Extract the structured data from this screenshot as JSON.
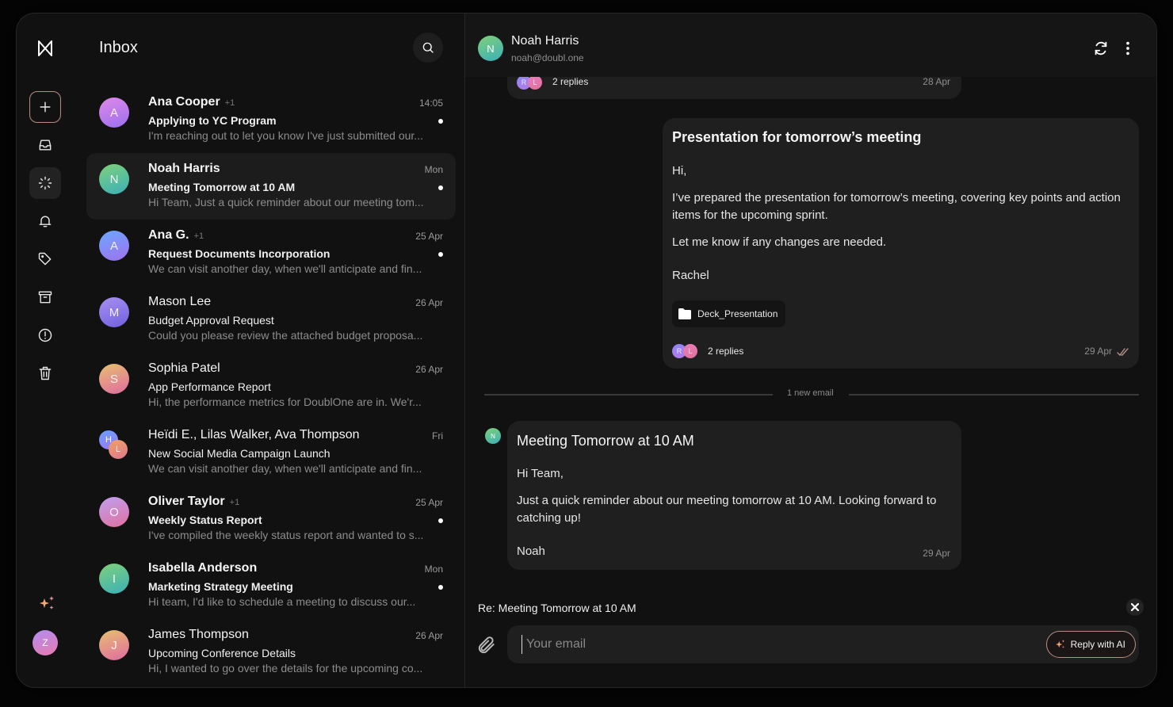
{
  "app": {
    "logo": "doublone-logo",
    "colors": {
      "accent": "#b88e84",
      "bg": "#111111",
      "card": "#1f1f1f",
      "selected": "#1c1c1c"
    }
  },
  "rail": {
    "items": [
      {
        "name": "compose",
        "icon": "plus-icon"
      },
      {
        "name": "inbox",
        "icon": "inbox-icon"
      },
      {
        "name": "loading",
        "icon": "loader-icon",
        "active": true
      },
      {
        "name": "notifications",
        "icon": "bell-icon"
      },
      {
        "name": "tags",
        "icon": "tag-icon"
      },
      {
        "name": "archive",
        "icon": "archive-icon"
      },
      {
        "name": "spam",
        "icon": "alert-icon"
      },
      {
        "name": "trash",
        "icon": "trash-icon"
      }
    ],
    "ai_icon": "sparkles-icon",
    "user_initial": "Z"
  },
  "list": {
    "title": "Inbox",
    "search_icon": "search-icon",
    "items": [
      {
        "initial": "A",
        "sender": "Ana Cooper",
        "extra": "+1",
        "time": "14:05",
        "subject": "Applying to YC Program",
        "preview": "I'm reaching out to let you know I've just submitted our...",
        "unread": true,
        "gradient": "linear-gradient(160deg,#e08ae8,#9b6ef0)"
      },
      {
        "initial": "N",
        "sender": "Noah Harris",
        "extra": "",
        "time": "Mon",
        "subject": "Meeting Tomorrow at 10 AM",
        "preview": "Hi Team, Just a quick reminder about our meeting tom...",
        "unread": true,
        "selected": true,
        "gradient": "linear-gradient(160deg,#7fd07a,#3ab0b8)"
      },
      {
        "initial": "A",
        "sender": "Ana G.",
        "extra": "+1",
        "time": "25 Apr",
        "subject": "Request Documents Incorporation",
        "preview": "We can visit another day, when we'll anticipate and fin...",
        "unread": true,
        "gradient": "linear-gradient(160deg,#6aa8ff,#a070f0)"
      },
      {
        "initial": "M",
        "sender": "Mason Lee",
        "extra": "",
        "time": "26 Apr",
        "subject": "Budget Approval Request",
        "preview": "Could you please review the attached budget proposa...",
        "unread": false,
        "gradient": "linear-gradient(160deg,#a890f0,#7060e0)"
      },
      {
        "initial": "S",
        "sender": "Sophia Patel",
        "extra": "",
        "time": "26 Apr",
        "subject": "App Performance Report",
        "preview": "Hi, the performance metrics for DoublOne are in. We'r...",
        "unread": false,
        "gradient": "linear-gradient(160deg,#e8c070,#e06aa0)"
      },
      {
        "initial": "H",
        "initial2": "L",
        "sender": "Heïdi E., Lilas Walker, Ava Thompson",
        "extra": "",
        "time": "Fri",
        "subject": "New Social Media Campaign Launch",
        "preview": "We can visit another day, when we'll anticipate and fin...",
        "unread": false,
        "pair": true
      },
      {
        "initial": "O",
        "sender": "Oliver Taylor",
        "extra": "+1",
        "time": "25 Apr",
        "subject": "Weekly Status Report",
        "preview": "I've compiled the weekly status report and wanted to s...",
        "unread": true,
        "gradient": "linear-gradient(160deg,#c0a0f0,#e070a0)"
      },
      {
        "initial": "I",
        "sender": "Isabella Anderson",
        "extra": "",
        "time": "Mon",
        "subject": "Marketing Strategy Meeting",
        "preview": "Hi team, I'd like to schedule a meeting to discuss our...",
        "unread": true,
        "gradient": "linear-gradient(160deg,#7fd07a,#3ab0b8)"
      },
      {
        "initial": "J",
        "sender": "James Thompson",
        "extra": "",
        "time": "26 Apr",
        "subject": "Upcoming Conference Details",
        "preview": "Hi, I wanted to go over the details for the upcoming co...",
        "unread": false,
        "gradient": "linear-gradient(160deg,#e8c070,#e06aa0)"
      }
    ]
  },
  "thread": {
    "header": {
      "initial": "N",
      "name": "Noah Harris",
      "email": "noah@doubl.one",
      "refresh_icon": "refresh-icon",
      "more_icon": "more-vertical-icon"
    },
    "top_card": {
      "avatars": [
        "R",
        "L"
      ],
      "replies": "2 replies",
      "date": "28 Apr"
    },
    "rachel_card": {
      "title": "Presentation for tomorrow’s meeting",
      "greeting": "Hi,",
      "body1": "I’ve prepared the presentation for tomorrow’s meeting, covering key points and action items for the upcoming sprint.",
      "body2": "Let me know if any changes are needed.",
      "signature": "Rachel",
      "attachment": "Deck_Presentation",
      "avatars": [
        "R",
        "L"
      ],
      "replies": "2 replies",
      "date": "29 Apr"
    },
    "separator": "1 new email",
    "noah_card": {
      "initial": "N",
      "title": "Meeting Tomorrow at 10 AM",
      "greeting": "Hi Team,",
      "body": "Just a quick reminder about our meeting tomorrow at 10 AM. Looking forward to catching up!",
      "signature": "Noah",
      "date": "29 Apr"
    },
    "compose": {
      "subject": "Re: Meeting Tomorrow at 10 AM",
      "placeholder": "Your email",
      "value": "",
      "ai_button": "Reply with AI"
    }
  }
}
